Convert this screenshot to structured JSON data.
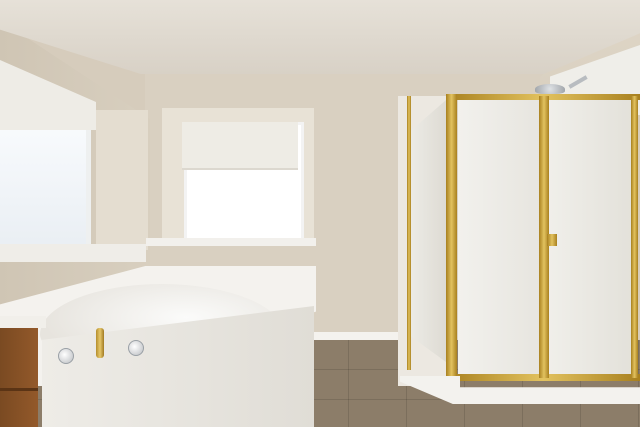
{
  "scene": {
    "description_type": "photo",
    "colors": {
      "wall": "#d9d0c1",
      "floor_tile": "#8c7d69",
      "tub": "#f4f2ee",
      "shower_frame": "#c9a63e",
      "vanity_wood": "#8a5428"
    },
    "icons": [
      "bathtub-icon",
      "shower-icon",
      "window-icon"
    ]
  }
}
